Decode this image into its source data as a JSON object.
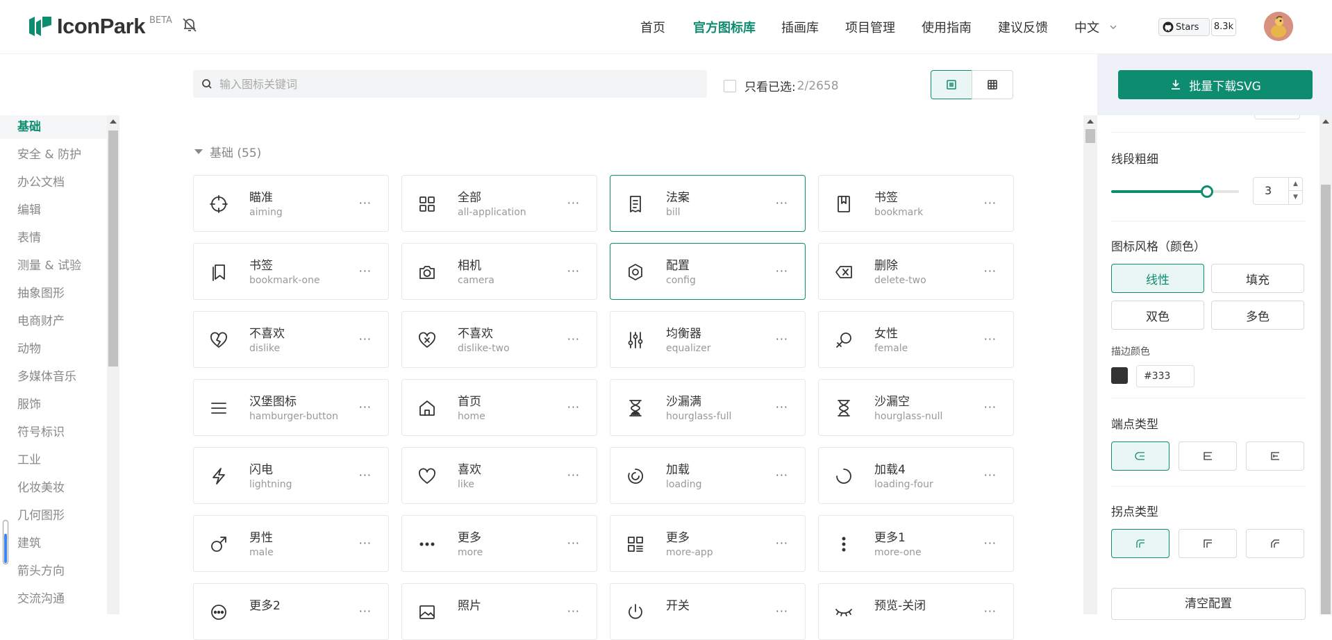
{
  "brand": {
    "name": "IconPark",
    "badge": "BETA"
  },
  "nav": {
    "items": [
      "首页",
      "官方图标库",
      "插画库",
      "项目管理",
      "使用指南",
      "建议反馈",
      "中文"
    ],
    "active_index": 1
  },
  "github": {
    "label": "Stars",
    "count": "8.3k"
  },
  "search": {
    "placeholder": "输入图标关键词",
    "value": ""
  },
  "filter": {
    "only_selected_label": "只看已选:",
    "selected_count": "2/2658"
  },
  "download": {
    "label": "批量下载SVG"
  },
  "sidebar": {
    "categories": [
      "基础",
      "安全 & 防护",
      "办公文档",
      "编辑",
      "表情",
      "测量 & 试验",
      "抽象图形",
      "电商财产",
      "动物",
      "多媒体音乐",
      "服饰",
      "符号标识",
      "工业",
      "化妆美妆",
      "几何图形",
      "建筑",
      "箭头方向",
      "交流沟通"
    ],
    "active_index": 0
  },
  "section": {
    "title": "基础 (55)"
  },
  "icons": [
    {
      "zh": "瞄准",
      "en": "aiming",
      "icon": "aiming-icon",
      "selected": false
    },
    {
      "zh": "全部",
      "en": "all-application",
      "icon": "all-application-icon",
      "selected": false
    },
    {
      "zh": "法案",
      "en": "bill",
      "icon": "bill-icon",
      "selected": true
    },
    {
      "zh": "书签",
      "en": "bookmark",
      "icon": "bookmark-icon",
      "selected": false
    },
    {
      "zh": "书签",
      "en": "bookmark-one",
      "icon": "bookmark-one-icon",
      "selected": false
    },
    {
      "zh": "相机",
      "en": "camera",
      "icon": "camera-icon",
      "selected": false
    },
    {
      "zh": "配置",
      "en": "config",
      "icon": "config-icon",
      "selected": true
    },
    {
      "zh": "删除",
      "en": "delete-two",
      "icon": "delete-two-icon",
      "selected": false
    },
    {
      "zh": "不喜欢",
      "en": "dislike",
      "icon": "dislike-icon",
      "selected": false
    },
    {
      "zh": "不喜欢",
      "en": "dislike-two",
      "icon": "dislike-two-icon",
      "selected": false
    },
    {
      "zh": "均衡器",
      "en": "equalizer",
      "icon": "equalizer-icon",
      "selected": false
    },
    {
      "zh": "女性",
      "en": "female",
      "icon": "female-icon",
      "selected": false
    },
    {
      "zh": "汉堡图标",
      "en": "hamburger-button",
      "icon": "hamburger-button-icon",
      "selected": false
    },
    {
      "zh": "首页",
      "en": "home",
      "icon": "home-icon",
      "selected": false
    },
    {
      "zh": "沙漏满",
      "en": "hourglass-full",
      "icon": "hourglass-full-icon",
      "selected": false
    },
    {
      "zh": "沙漏空",
      "en": "hourglass-null",
      "icon": "hourglass-null-icon",
      "selected": false
    },
    {
      "zh": "闪电",
      "en": "lightning",
      "icon": "lightning-icon",
      "selected": false
    },
    {
      "zh": "喜欢",
      "en": "like",
      "icon": "like-icon",
      "selected": false
    },
    {
      "zh": "加载",
      "en": "loading",
      "icon": "loading-icon",
      "selected": false
    },
    {
      "zh": "加载4",
      "en": "loading-four",
      "icon": "loading-four-icon",
      "selected": false
    },
    {
      "zh": "男性",
      "en": "male",
      "icon": "male-icon",
      "selected": false
    },
    {
      "zh": "更多",
      "en": "more",
      "icon": "more-icon",
      "selected": false
    },
    {
      "zh": "更多",
      "en": "more-app",
      "icon": "more-app-icon",
      "selected": false
    },
    {
      "zh": "更多1",
      "en": "more-one",
      "icon": "more-one-icon",
      "selected": false
    },
    {
      "zh": "更多2",
      "en": "",
      "icon": "more-two-icon",
      "selected": false
    },
    {
      "zh": "照片",
      "en": "",
      "icon": "picture-icon",
      "selected": false
    },
    {
      "zh": "开关",
      "en": "",
      "icon": "power-icon",
      "selected": false
    },
    {
      "zh": "预览-关闭",
      "en": "",
      "icon": "preview-close-icon",
      "selected": false
    }
  ],
  "settings": {
    "stroke_width_label": "线段粗细",
    "stroke_width_value": "3",
    "stroke_width_fraction": 0.75,
    "style_label": "图标风格（颜色）",
    "styles": [
      "线性",
      "填充",
      "双色",
      "多色"
    ],
    "style_active_index": 0,
    "stroke_color_label": "描边颜色",
    "stroke_color_value": "#333",
    "linecap_label": "端点类型",
    "linecap_active_index": 0,
    "linejoin_label": "拐点类型",
    "linejoin_active_index": 0,
    "clear_label": "清空配置"
  },
  "colors": {
    "accent": "#0e8c6f",
    "stroke": "#333333"
  }
}
